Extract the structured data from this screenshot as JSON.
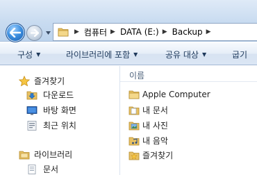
{
  "address": {
    "breadcrumbs": [
      "컴퓨터",
      "DATA (E:)",
      "Backup"
    ],
    "separator": "▶"
  },
  "toolbar": {
    "organize_label": "구성",
    "include_in_library_label": "라이브러리에 포함",
    "share_with_label": "공유 대상",
    "burn_label": "굽기"
  },
  "navpane": {
    "favorites": {
      "label": "즐겨찾기",
      "items": [
        "다운로드",
        "바탕 화면",
        "최근 위치"
      ]
    },
    "libraries": {
      "label": "라이브러리",
      "items": [
        "문서"
      ]
    }
  },
  "content": {
    "column_name": "이름",
    "items": [
      "Apple Computer",
      "내 문서",
      "내 사진",
      "내 음악",
      "즐겨찾기"
    ]
  },
  "colors": {
    "nav_back": "#3d8fe0",
    "toolbar_text": "#1e395b",
    "folder": "#e8c163"
  }
}
